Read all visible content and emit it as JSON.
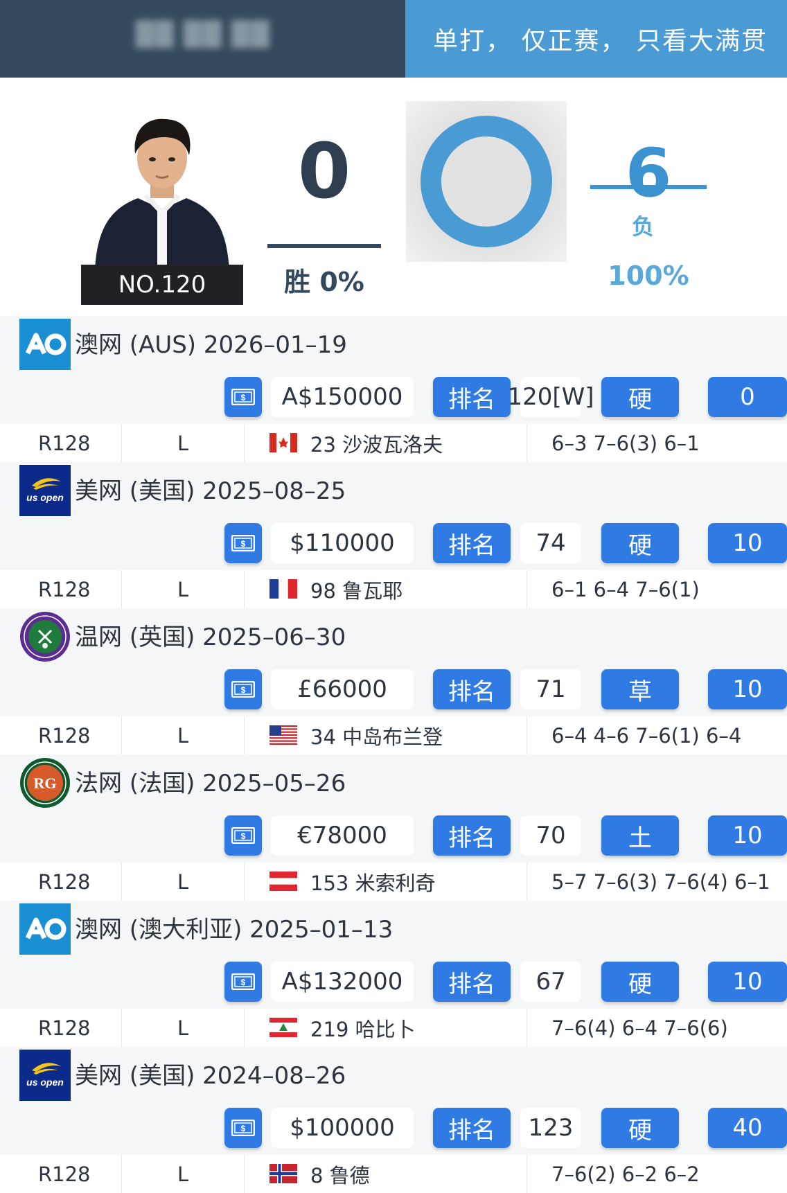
{
  "header": {
    "player_name_blurred": "██ ██ ██",
    "filter_text": "单打， 仅正赛， 只看大满贯"
  },
  "stats": {
    "rank_badge": "NO.120",
    "wins": "0",
    "wins_label": "胜 0%",
    "losses": "6",
    "losses_unit": "负",
    "losses_pct": "100%",
    "loss_fraction": 1.0,
    "colors": {
      "accent": "#4a9bd4",
      "dark": "#34495e",
      "chip_blue": "#2f7be3"
    }
  },
  "matches": [
    {
      "logo": "ao-logo-icon",
      "title": "澳网 (AUS) 2026–01–19",
      "prize": "A$150000",
      "rank_label": "排名",
      "rank": "120[W]",
      "surface": "硬",
      "points": "0",
      "round": "R128",
      "result": "L",
      "flag": "canada-flag-icon",
      "opponent": "23 沙波瓦洛夫",
      "score": "6–3 7–6(3) 6–1"
    },
    {
      "logo": "usopen-logo-icon",
      "title": "美网 (美国) 2025–08–25",
      "prize": "$110000",
      "rank_label": "排名",
      "rank": "74",
      "surface": "硬",
      "points": "10",
      "round": "R128",
      "result": "L",
      "flag": "france-flag-icon",
      "opponent": "98 鲁瓦耶",
      "score": "6–1 6–4 7–6(1)"
    },
    {
      "logo": "wimbledon-logo-icon",
      "title": "温网 (英国) 2025–06–30",
      "prize": "£66000",
      "rank_label": "排名",
      "rank": "71",
      "surface": "草",
      "points": "10",
      "round": "R128",
      "result": "L",
      "flag": "usa-flag-icon",
      "opponent": "34 中岛布兰登",
      "score": "6–4 4–6 7–6(1) 6–4"
    },
    {
      "logo": "roland-garros-logo-icon",
      "title": "法网 (法国) 2025–05–26",
      "prize": "€78000",
      "rank_label": "排名",
      "rank": "70",
      "surface": "土",
      "points": "10",
      "round": "R128",
      "result": "L",
      "flag": "austria-flag-icon",
      "opponent": "153 米索利奇",
      "score": "5–7 7–6(3) 7–6(4) 6–1"
    },
    {
      "logo": "ao-logo-icon",
      "title": "澳网 (澳大利亚) 2025–01–13",
      "prize": "A$132000",
      "rank_label": "排名",
      "rank": "67",
      "surface": "硬",
      "points": "10",
      "round": "R128",
      "result": "L",
      "flag": "lebanon-flag-icon",
      "opponent": "219 哈比卜",
      "score": "7–6(4) 6–4 7–6(6)"
    },
    {
      "logo": "usopen-logo-icon",
      "title": "美网 (美国) 2024–08–26",
      "prize": "$100000",
      "rank_label": "排名",
      "rank": "123",
      "surface": "硬",
      "points": "40",
      "round": "R128",
      "result": "L",
      "flag": "norway-flag-icon",
      "opponent": "8 鲁德",
      "score": "7–6(2) 6–2 6–2"
    }
  ]
}
